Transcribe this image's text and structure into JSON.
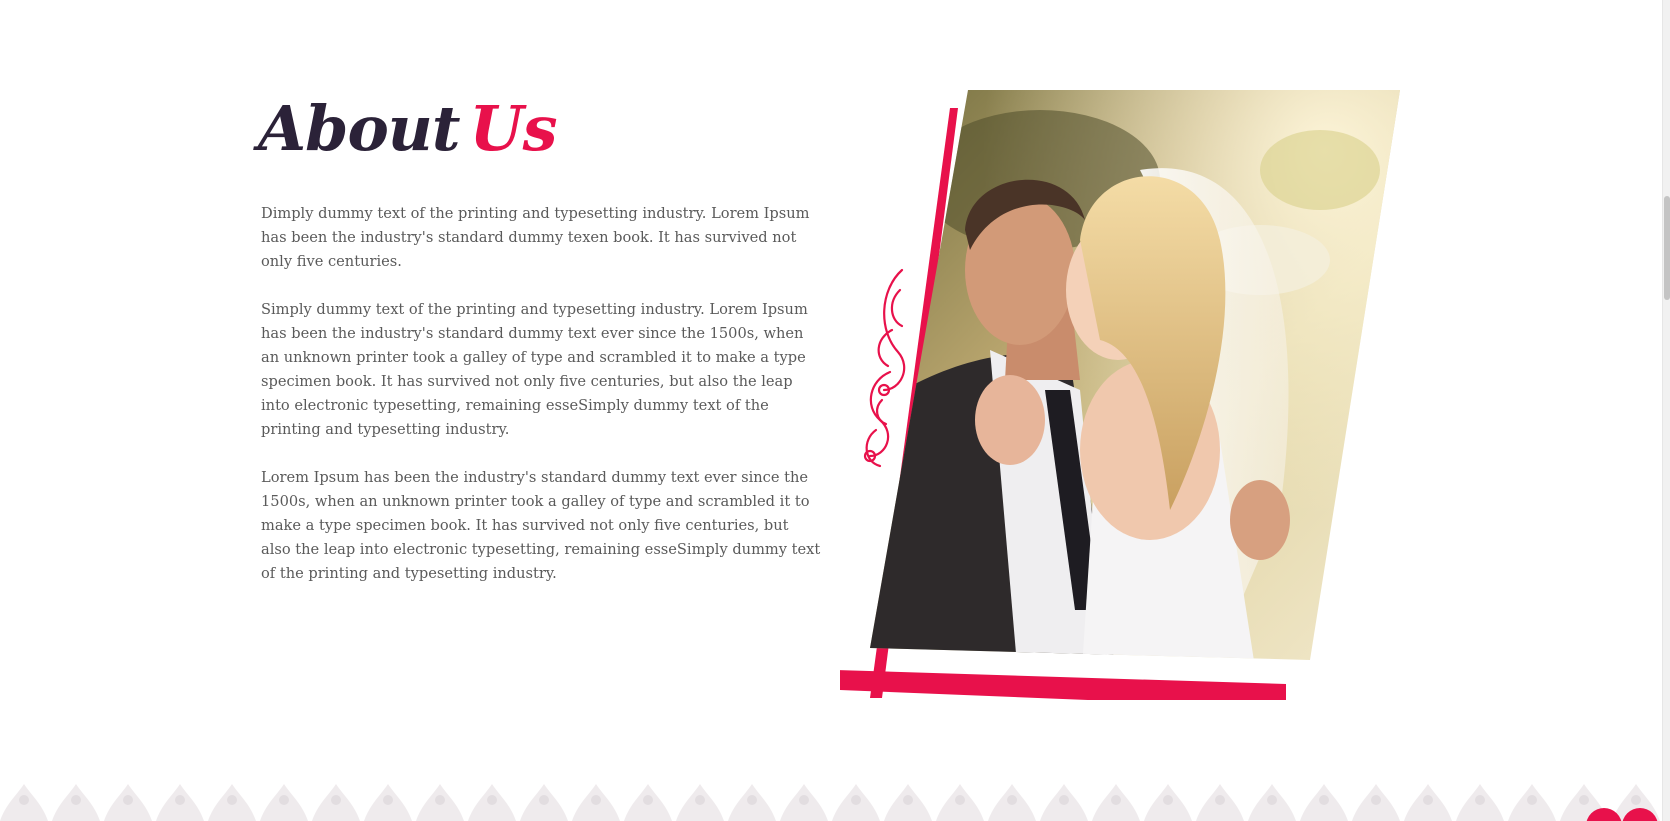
{
  "about": {
    "title_word1": "About",
    "title_word2": "Us",
    "paragraphs": [
      "Dimply dummy text of the printing and typesetting industry. Lorem Ipsum has been the industry's standard dummy texen book. It has survived not only five centuries.",
      "Simply dummy text of the printing and typesetting industry. Lorem Ipsum has been the industry's standard dummy text ever since the 1500s, when an unknown printer took a galley of type and scrambled it to make a type specimen book. It has survived not only five centuries, but also the leap into electronic typesetting, remaining esseSimply dummy text of the printing and typesetting industry.",
      "Lorem Ipsum has been the industry's standard dummy text ever since the 1500s, when an unknown printer took a galley of type and scrambled it to make a type specimen book. It has survived not only five centuries, but also the leap into electronic typesetting, remaining esseSimply dummy text of the printing and typesetting industry."
    ]
  },
  "photo": {
    "subject": "wedding-couple-photo"
  },
  "colors": {
    "accent": "#e8114b",
    "title_dark": "#2b2238",
    "body_text": "#5a5a5a"
  }
}
